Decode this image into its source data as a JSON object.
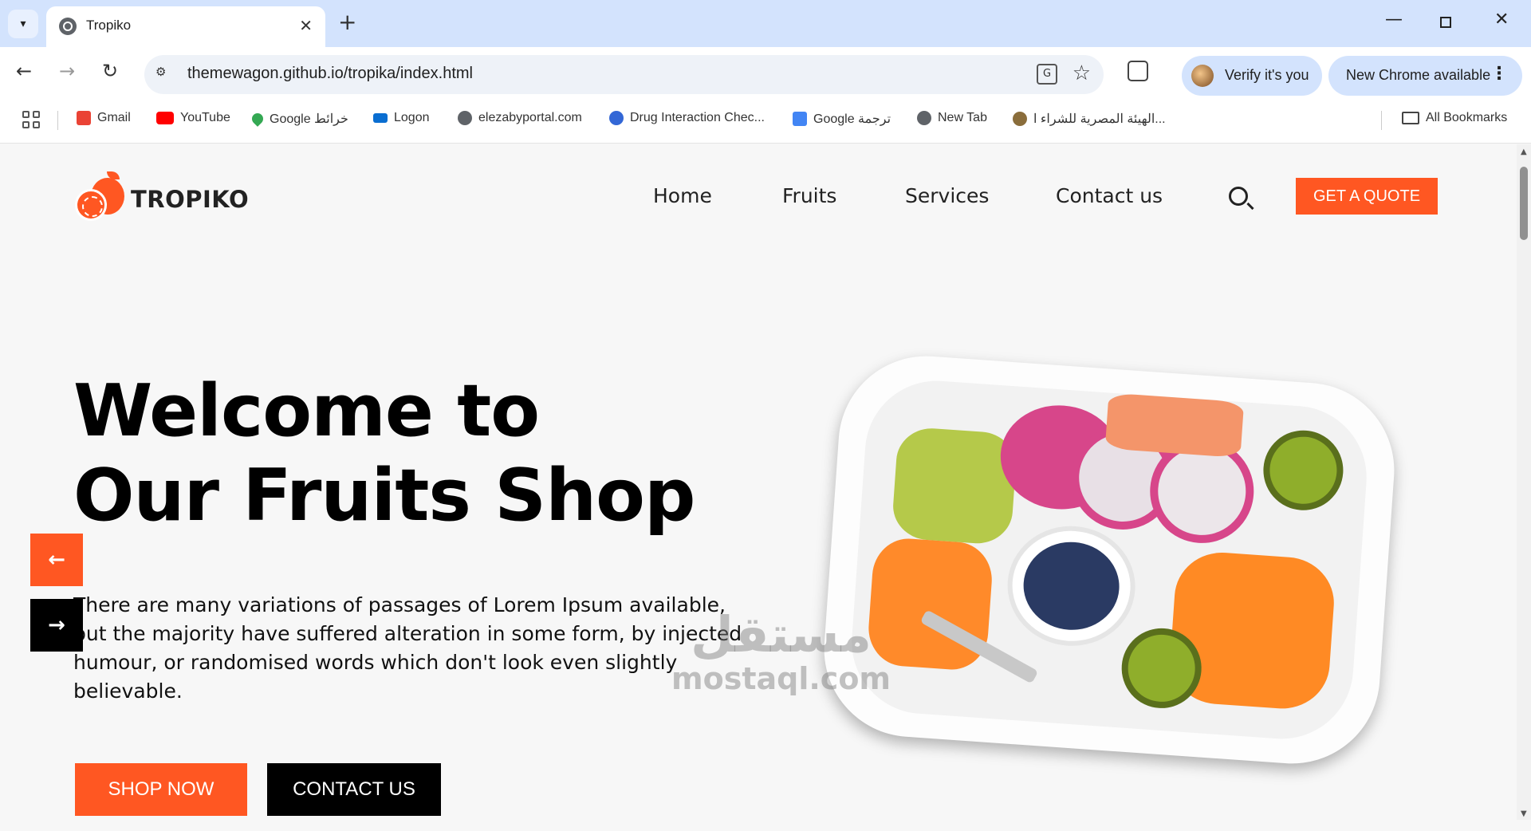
{
  "browser": {
    "tab_title": "Tropiko",
    "url": "themewagon.github.io/tropika/index.html",
    "verify_label": "Verify it's you",
    "update_label": "New Chrome available",
    "bookmarks": [
      {
        "label": "Gmail",
        "icon": "gmail-icon",
        "color": "#ea4335"
      },
      {
        "label": "YouTube",
        "icon": "youtube-icon",
        "color": "#ff0000"
      },
      {
        "label": "Google خرائط",
        "icon": "maps-icon",
        "color": "#34a853"
      },
      {
        "label": "Logon",
        "icon": "sap-icon",
        "color": "#0a6ed1"
      },
      {
        "label": "elezabyportal.com",
        "icon": "globe-icon",
        "color": "#5f6368"
      },
      {
        "label": "Drug Interaction Chec...",
        "icon": "w-icon",
        "color": "#3367d6"
      },
      {
        "label": "Google ترجمة",
        "icon": "translate-icon",
        "color": "#4285f4"
      },
      {
        "label": "New Tab",
        "icon": "globe-icon",
        "color": "#5f6368"
      },
      {
        "label": "الهيئة المصرية للشراء ا...",
        "icon": "emblem-icon",
        "color": "#8a6d3b"
      }
    ],
    "all_bookmarks_label": "All Bookmarks"
  },
  "site": {
    "brand": "TROPIKO",
    "nav": [
      "Home",
      "Fruits",
      "Services",
      "Contact us"
    ],
    "quote_button": "GET A QUOTE",
    "hero": {
      "line1": "Welcome to",
      "line2": "Our Fruits Shop",
      "description": "There are many variations of passages of Lorem Ipsum available, but the majority have suffered alteration in some form, by injected humour, or randomised words which don't look even slightly believable.",
      "shop_button": "SHOP NOW",
      "contact_button": "CONTACT US"
    },
    "accent_color": "#ff5722"
  },
  "watermark": {
    "arabic": "مستقل",
    "latin": "mostaql.com"
  }
}
